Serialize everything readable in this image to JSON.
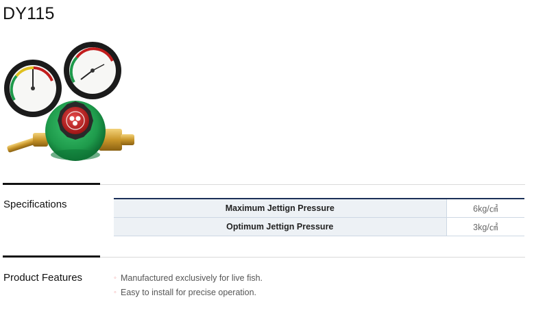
{
  "product": {
    "title": "DY115",
    "image_alt": "Dual-gauge pressure regulator"
  },
  "specifications": {
    "heading": "Specifications",
    "rows": [
      {
        "label": "Maximum Jettign Pressure",
        "value": "6kg/㎠"
      },
      {
        "label": "Optimum Jettign Pressure",
        "value": "3kg/㎠"
      }
    ]
  },
  "features": {
    "heading": "Product Features",
    "bullet": "◦",
    "items": [
      "Manufactured exclusively for live fish.",
      "Easy to install for precise operation."
    ]
  },
  "colors": {
    "header_border": "#1a2f57",
    "label_bg": "#edf1f5",
    "regulator_green": "#1e9a4b",
    "brass": "#d4a93a"
  }
}
